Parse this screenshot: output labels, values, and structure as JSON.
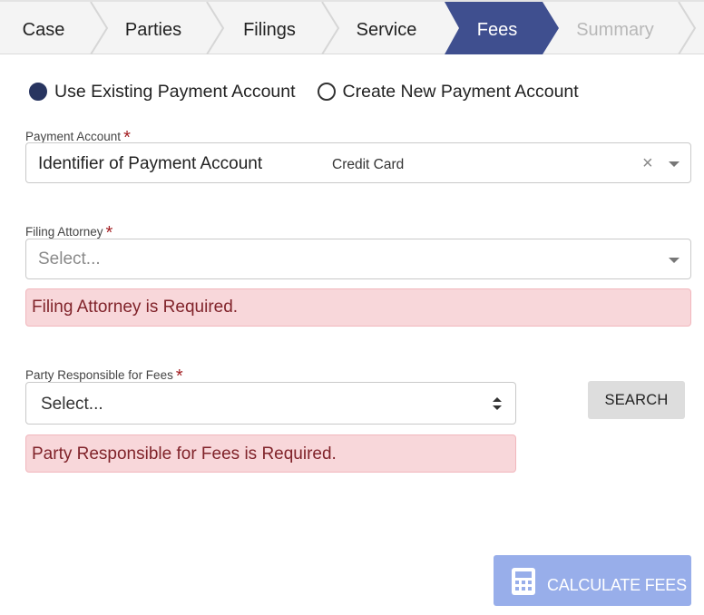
{
  "wizard": {
    "steps": [
      {
        "label": "Case",
        "state": "default"
      },
      {
        "label": "Parties",
        "state": "default"
      },
      {
        "label": "Filings",
        "state": "default"
      },
      {
        "label": "Service",
        "state": "default"
      },
      {
        "label": "Fees",
        "state": "active"
      },
      {
        "label": "Summary",
        "state": "disabled"
      }
    ]
  },
  "payment_mode": {
    "options": [
      {
        "label": "Use Existing Payment Account",
        "checked": true
      },
      {
        "label": "Create New Payment Account",
        "checked": false
      }
    ]
  },
  "payment_account": {
    "label": "Payment Account",
    "required_marker": "*",
    "value": "Identifier of Payment Account",
    "type": "Credit Card",
    "clear_glyph": "×"
  },
  "filing_attorney": {
    "label": "Filing Attorney",
    "required_marker": "*",
    "placeholder": "Select...",
    "error": "Filing Attorney is Required."
  },
  "party_responsible": {
    "label": "Party Responsible for Fees",
    "required_marker": "*",
    "placeholder": "Select...",
    "error": "Party Responsible for Fees is Required.",
    "search_label": "SEARCH"
  },
  "actions": {
    "calculate_label": "CALCULATE FEES",
    "calculate_icon": "calculator-icon"
  },
  "colors": {
    "active_step": "#3f4f8f",
    "radio_checked": "#283560",
    "required": "#a31f23",
    "error_bg": "#f8d7da",
    "error_text": "#80232a",
    "calculate_bg": "#98aeea"
  }
}
